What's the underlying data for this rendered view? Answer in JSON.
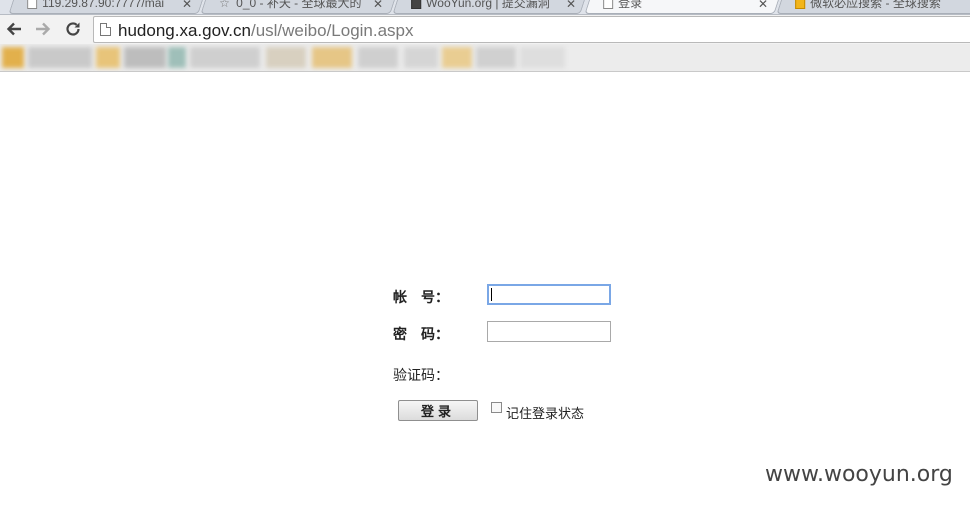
{
  "tabs": [
    {
      "title": "119.29.87.90:7777/mai"
    },
    {
      "title": "0_0 - 补天 - 全球最大的"
    },
    {
      "title": "WooYun.org | 提交漏洞"
    },
    {
      "title": "登录"
    },
    {
      "title": "微软必应搜索 - 全球搜索"
    }
  ],
  "omnibox": {
    "host": "hudong.xa.gov.cn",
    "path": "/usl/weibo/Login.aspx"
  },
  "login": {
    "account_label": "帐　号：",
    "password_label": "密　码：",
    "captcha_label": "验证码：",
    "submit_label": "登录",
    "remember_label": "记住登录状态",
    "account_value": "",
    "password_value": "",
    "remember_checked": false
  },
  "watermark": "www.wooyun.org",
  "colors": {
    "focus": "#7aa7e6",
    "tab_active": "#f6f7f9",
    "bookmark_tint": "#e0b44a"
  }
}
